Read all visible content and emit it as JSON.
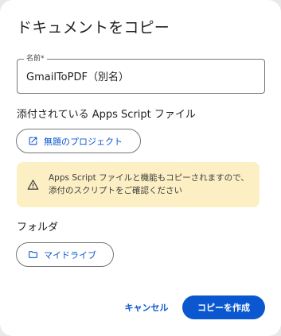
{
  "dialog": {
    "title": "ドキュメントをコピー"
  },
  "name_field": {
    "label": "名前*",
    "value": "GmailToPDF（別名）"
  },
  "script_section": {
    "title": "添付されている Apps Script ファイル",
    "project_button": {
      "icon": "open-in-new-icon",
      "label": "無題のプロジェクト"
    }
  },
  "warning": {
    "icon": "warning-icon",
    "text": "Apps Script ファイルと機能もコピーされますので、添付のスクリプトをご確認ください"
  },
  "folder_section": {
    "title": "フォルダ",
    "folder_button": {
      "icon": "folder-icon",
      "label": "マイドライブ"
    }
  },
  "actions": {
    "cancel_label": "キャンセル",
    "copy_label": "コピーを作成"
  },
  "colors": {
    "accent": "#0b57d0",
    "warning_background": "#fdefc4",
    "outline": "#747775",
    "text": "#1f1f1f"
  }
}
